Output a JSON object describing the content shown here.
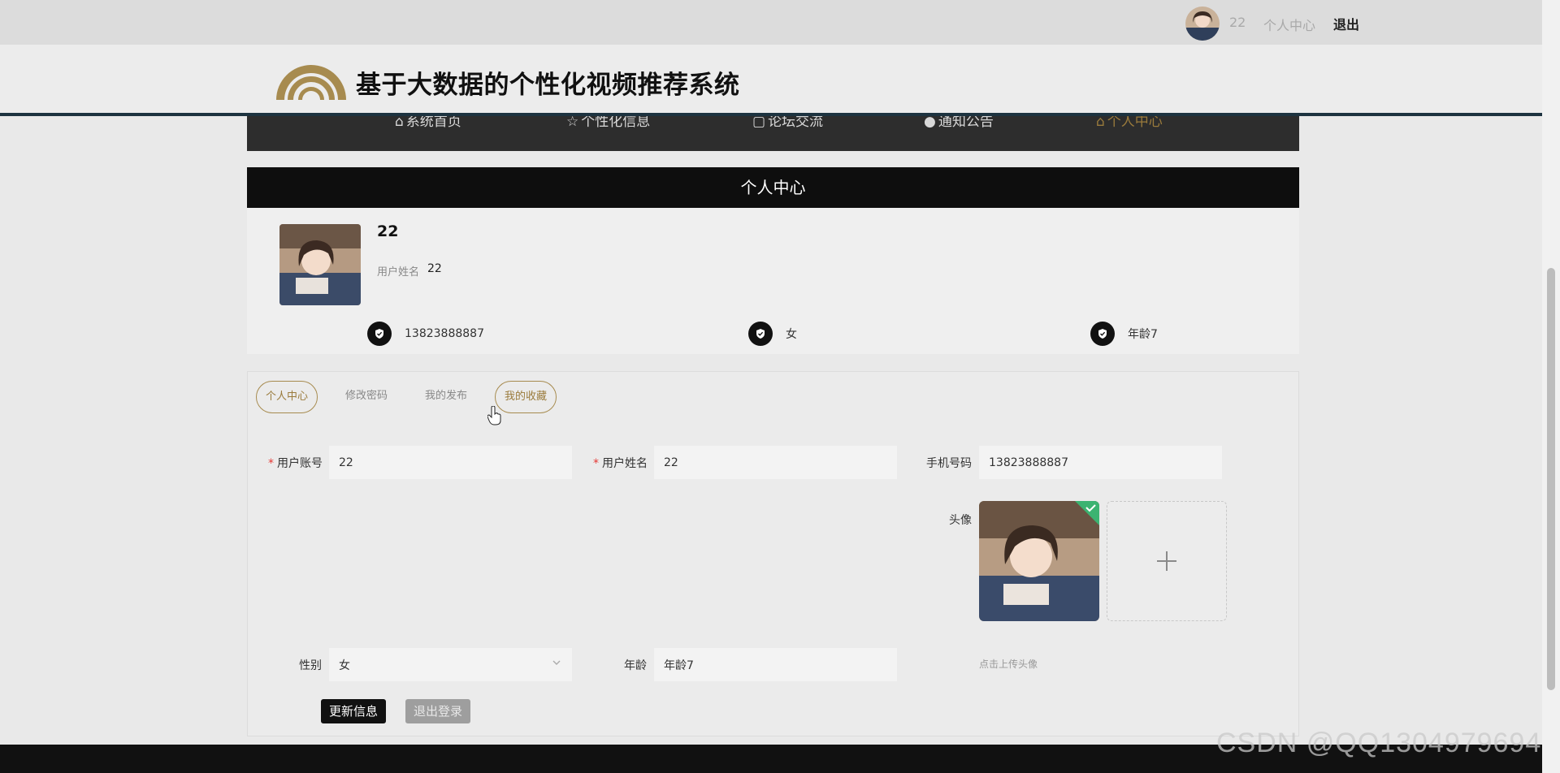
{
  "topbar": {
    "username": "22",
    "personal_center": "个人中心",
    "logout": "退出"
  },
  "header": {
    "site_title": "基于大数据的个性化视频推荐系统",
    "logo_icon": "arc-logo-icon",
    "accent_color": "#a78b4f"
  },
  "nav": {
    "items": [
      {
        "label": "系统首页",
        "icon": "home-icon"
      },
      {
        "label": "个性化信息",
        "icon": "star-icon"
      },
      {
        "label": "论坛交流",
        "icon": "bag-icon"
      },
      {
        "label": "通知公告",
        "icon": "info-icon"
      },
      {
        "label": "个人中心",
        "icon": "home-icon"
      }
    ],
    "active_index": 4
  },
  "section": {
    "title": "个人中心"
  },
  "profile": {
    "name": "22",
    "realname_label": "用户姓名",
    "realname_value": "22",
    "phone": "13823888887",
    "gender": "女",
    "age": "年龄7"
  },
  "tabs": [
    {
      "label": "个人中心",
      "active": true
    },
    {
      "label": "修改密码",
      "active": false
    },
    {
      "label": "我的发布",
      "active": false
    },
    {
      "label": "我的收藏",
      "active": false
    }
  ],
  "form": {
    "account_label": "用户账号",
    "account_value": "22",
    "realname_label": "用户姓名",
    "realname_value": "22",
    "phone_label": "手机号码",
    "phone_value": "13823888887",
    "avatar_label": "头像",
    "upload_tip": "点击上传头像",
    "gender_label": "性别",
    "gender_value": "女",
    "age_label": "年龄",
    "age_value": "年龄7",
    "update_button": "更新信息",
    "logout_button": "退出登录"
  },
  "watermark": "CSDN @QQ1304979694"
}
